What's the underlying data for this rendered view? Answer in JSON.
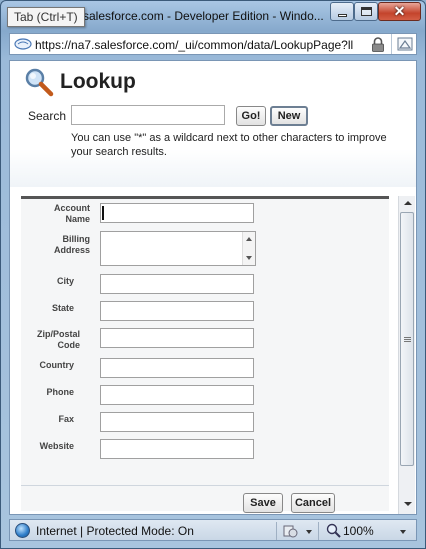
{
  "window": {
    "title": "salesforce.com - Developer Edition - Windo...",
    "tooltip": "Tab (Ctrl+T)",
    "url": "https://na7.salesforce.com/_ui/common/data/LookupPage?ll"
  },
  "header": {
    "title": "Lookup",
    "search_label": "Search",
    "search_value": "",
    "go_label": "Go!",
    "new_label": "New",
    "hint": "You can use \"*\" as a wildcard next to other characters to improve your search results."
  },
  "form": {
    "fields": [
      {
        "label": "Account Name",
        "value": ""
      },
      {
        "label": "Billing Address",
        "value": ""
      },
      {
        "label": "City",
        "value": ""
      },
      {
        "label": "State",
        "value": ""
      },
      {
        "label": "Zip/Postal Code",
        "value": ""
      },
      {
        "label": "Country",
        "value": ""
      },
      {
        "label": "Phone",
        "value": ""
      },
      {
        "label": "Fax",
        "value": ""
      },
      {
        "label": "Website",
        "value": ""
      }
    ],
    "save_label": "Save",
    "cancel_label": "Cancel"
  },
  "statusbar": {
    "zone": "Internet | Protected Mode: On",
    "zoom": "100%"
  },
  "colors": {
    "frame": "#a9c6e4",
    "form_background": "#f5f6f7",
    "close_button": "#c4442c"
  }
}
